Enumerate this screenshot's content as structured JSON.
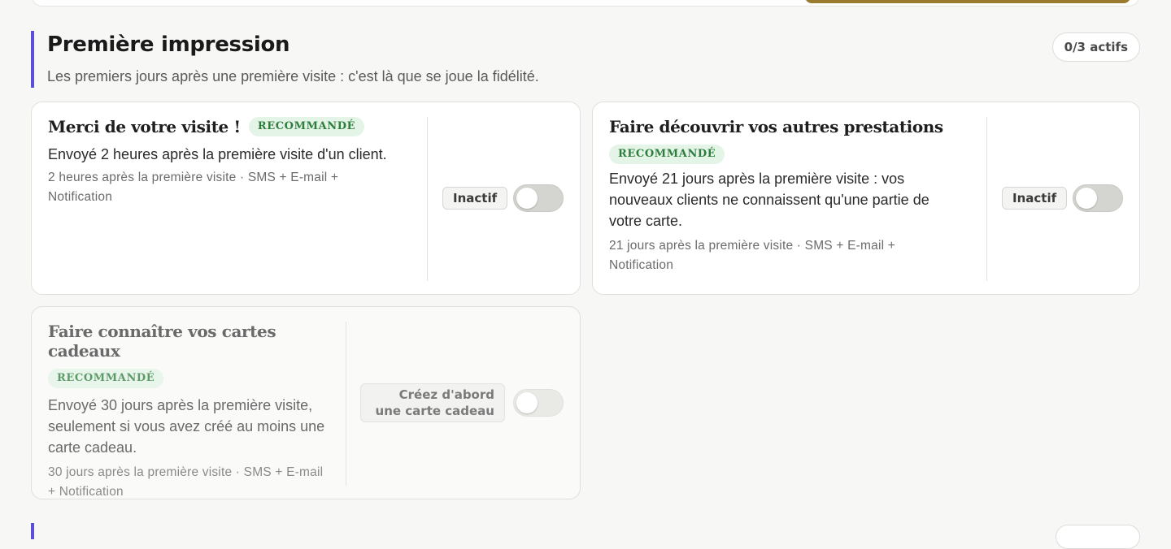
{
  "section": {
    "title": "Première impression",
    "subtitle": "Les premiers jours après une première visite : c'est là que se joue la fidélité.",
    "active_count": "0/3 actifs"
  },
  "cards": [
    {
      "title": "Merci de votre visite !",
      "badge": "RECOMMANDÉ",
      "description": "Envoyé 2 heures après la première visite d'un client.",
      "meta": "2 heures après la première visite · SMS + E-mail + Notification",
      "status": "Inactif",
      "enabled": false
    },
    {
      "title": "Faire découvrir vos autres prestations",
      "badge": "RECOMMANDÉ",
      "description": "Envoyé 21 jours après la première visite : vos nouveaux clients ne connaissent qu'une partie de votre carte.",
      "meta": "21 jours après la première visite · SMS + E-mail + Notification",
      "status": "Inactif",
      "enabled": false
    },
    {
      "title": "Faire connaître vos cartes cadeaux",
      "badge": "RECOMMANDÉ",
      "description": "Envoyé 30 jours après la première visite, seulement si vous avez créé au moins une carte cadeau.",
      "meta": "30 jours après la première visite · SMS + E-mail + Notification",
      "status": "Créez d'abord une carte cadeau",
      "enabled": false
    }
  ],
  "colors": {
    "accent_bar": "#5b4fd6",
    "badge_bg": "#e4f5e7",
    "badge_text": "#2f7d3e",
    "top_button": "#9a7a2e"
  }
}
